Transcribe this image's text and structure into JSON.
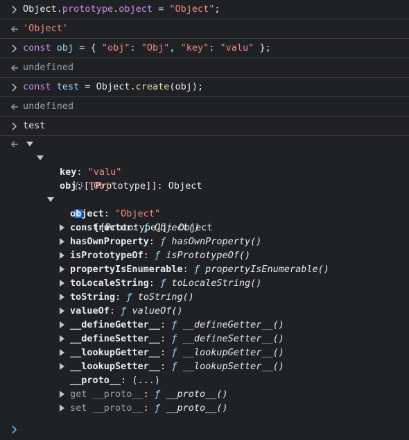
{
  "entries": [
    {
      "kind": "input",
      "tokens": [
        {
          "t": "Object",
          "c": "prop"
        },
        {
          "t": ".",
          "c": "prop"
        },
        {
          "t": "prototype",
          "c": "kw"
        },
        {
          "t": ".",
          "c": "prop"
        },
        {
          "t": "object",
          "c": "kw"
        },
        {
          "t": " = ",
          "c": "prop"
        },
        {
          "t": "\"Object\"",
          "c": "str"
        },
        {
          "t": ";",
          "c": "prop"
        }
      ]
    },
    {
      "kind": "output",
      "text": "'Object'",
      "is_string": true
    },
    {
      "kind": "input",
      "tokens": [
        {
          "t": "const",
          "c": "kw"
        },
        {
          "t": " ",
          "c": "prop"
        },
        {
          "t": "obj",
          "c": "var"
        },
        {
          "t": " = { ",
          "c": "prop"
        },
        {
          "t": "\"obj\"",
          "c": "str"
        },
        {
          "t": ": ",
          "c": "prop"
        },
        {
          "t": "\"Obj\"",
          "c": "str"
        },
        {
          "t": ", ",
          "c": "prop"
        },
        {
          "t": "\"key\"",
          "c": "str"
        },
        {
          "t": ": ",
          "c": "prop"
        },
        {
          "t": "\"valu\"",
          "c": "str"
        },
        {
          "t": " };",
          "c": "prop"
        }
      ]
    },
    {
      "kind": "output",
      "text": "undefined",
      "is_string": false
    },
    {
      "kind": "input",
      "tokens": [
        {
          "t": "const",
          "c": "kw"
        },
        {
          "t": " ",
          "c": "prop"
        },
        {
          "t": "test",
          "c": "var"
        },
        {
          "t": " = Object.",
          "c": "prop"
        },
        {
          "t": "create",
          "c": "fn"
        },
        {
          "t": "(obj);",
          "c": "prop"
        }
      ]
    },
    {
      "kind": "output",
      "text": "undefined",
      "is_string": false
    },
    {
      "kind": "input",
      "tokens": [
        {
          "t": "test",
          "c": "prop"
        }
      ]
    }
  ],
  "object_view": {
    "summary": "{}",
    "info_badge": "i",
    "prototype_label": "[[Prototype]]",
    "prototype_type": "Object",
    "own_props": [
      {
        "name": "key",
        "value": "\"valu\""
      },
      {
        "name": "obj",
        "value": "\"Obj\""
      }
    ],
    "inner_prototype": {
      "label": "[[Prototype]]",
      "type": "Object",
      "props": [
        {
          "name": "object",
          "kind": "value",
          "value": "\"Object\""
        },
        {
          "name": "constructor",
          "kind": "fn",
          "fn": "Object()"
        },
        {
          "name": "hasOwnProperty",
          "kind": "fn",
          "fn": "hasOwnProperty()"
        },
        {
          "name": "isPrototypeOf",
          "kind": "fn",
          "fn": "isPrototypeOf()"
        },
        {
          "name": "propertyIsEnumerable",
          "kind": "fn",
          "fn": "propertyIsEnumerable()"
        },
        {
          "name": "toLocaleString",
          "kind": "fn",
          "fn": "toLocaleString()"
        },
        {
          "name": "toString",
          "kind": "fn",
          "fn": "toString()"
        },
        {
          "name": "valueOf",
          "kind": "fn",
          "fn": "valueOf()"
        },
        {
          "name": "__defineGetter__",
          "kind": "fn",
          "fn": "__defineGetter__()"
        },
        {
          "name": "__defineSetter__",
          "kind": "fn",
          "fn": "__defineSetter__()"
        },
        {
          "name": "__lookupGetter__",
          "kind": "fn",
          "fn": "__lookupGetter__()"
        },
        {
          "name": "__lookupSetter__",
          "kind": "fn",
          "fn": "__lookupSetter__()"
        },
        {
          "name": "__proto__",
          "kind": "lazy",
          "value": "(...)"
        },
        {
          "name": "get __proto__",
          "kind": "accessor",
          "fn": "__proto__()"
        },
        {
          "name": "set __proto__",
          "kind": "accessor",
          "fn": "__proto__()"
        }
      ]
    },
    "function_symbol": "ƒ"
  },
  "colors": {
    "background": "#202124",
    "divider": "#3c3c3c",
    "keyword": "#c792ea",
    "string": "#f28b82",
    "function_symbol": "#9cdcfe",
    "prompt_accent": "#4fc3f7"
  }
}
